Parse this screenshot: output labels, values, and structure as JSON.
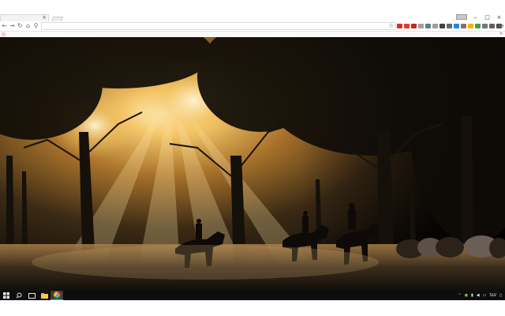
{
  "browser": {
    "tab_close_glyph": "×",
    "window_controls": {
      "minimize": "–",
      "maximize": "□",
      "close": "×"
    },
    "omnibox": {
      "value": "",
      "placeholder": ""
    },
    "nav": {
      "back": "←",
      "forward": "→",
      "reload": "↻",
      "home": "⌂",
      "search": "⚲"
    },
    "star": "☆",
    "extensions": [
      {
        "name": "extension-icon-1",
        "color": "#d93025"
      },
      {
        "name": "extension-icon-2",
        "color": "#e53935"
      },
      {
        "name": "extension-icon-3",
        "color": "#c62828"
      },
      {
        "name": "extension-icon-4",
        "color": "#9e9e9e"
      },
      {
        "name": "extension-icon-5",
        "color": "#607d8b"
      },
      {
        "name": "extension-icon-6",
        "color": "#9e9e9e"
      },
      {
        "name": "extension-icon-7",
        "color": "#424242"
      },
      {
        "name": "extension-icon-8",
        "color": "#546e7a"
      },
      {
        "name": "extension-icon-9",
        "color": "#1e88e5"
      },
      {
        "name": "extension-icon-10",
        "color": "#8d6e63"
      },
      {
        "name": "extension-icon-11",
        "color": "#f4b400"
      },
      {
        "name": "extension-icon-12",
        "color": "#43a047"
      },
      {
        "name": "extension-icon-13",
        "color": "#757575"
      },
      {
        "name": "extension-icon-14",
        "color": "#616161"
      },
      {
        "name": "extension-icon-15",
        "color": "#4a4a4a"
      }
    ],
    "bookmarks_chevron": "»"
  },
  "taskbar": {
    "tray_text": "SLV",
    "chevron": "⌃"
  },
  "colors": {
    "taskbar_bg": "#0d0d0d",
    "active_app_highlight": "#3b3b3b",
    "accent": "#88b4e0"
  }
}
